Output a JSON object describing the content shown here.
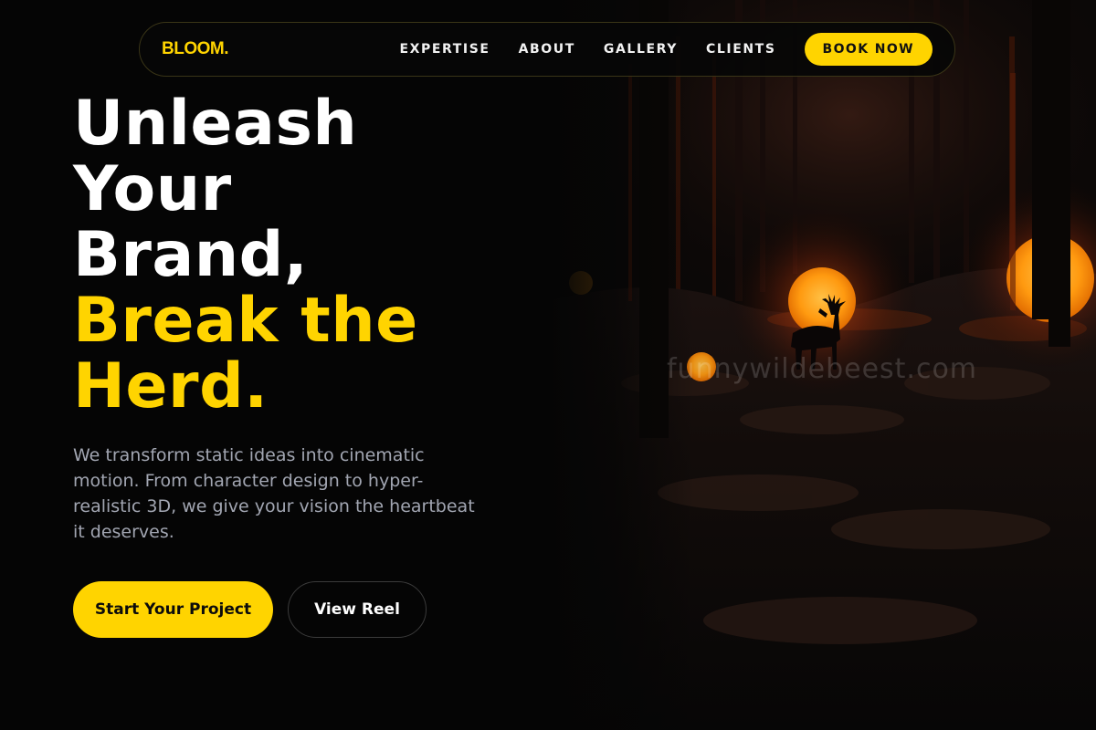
{
  "brand": {
    "logo": "BLOOM.",
    "accent_color": "#ffd400"
  },
  "nav": {
    "links": [
      "EXPERTISE",
      "ABOUT",
      "GALLERY",
      "CLIENTS"
    ],
    "cta": "BOOK NOW"
  },
  "hero": {
    "headline_lines": [
      "Unleash",
      "Your",
      "Brand,"
    ],
    "headline_accent_lines": [
      "Break the",
      "Herd."
    ],
    "subtext": "We transform static ideas into cinematic motion. From character design to hyper-realistic 3D, we give your vision the heartbeat it deserves.",
    "primary_cta": "Start Your Project",
    "secondary_cta": "View Reel",
    "image": {
      "subject": "deer-silhouette-in-dark-forest-with-glowing-orange-orbs",
      "watermark": "funnywildebeest.com"
    }
  },
  "colors": {
    "background": "#050505",
    "text": "#ffffff",
    "muted_text": "#a2a6b2",
    "glow": "#ff9a14"
  }
}
